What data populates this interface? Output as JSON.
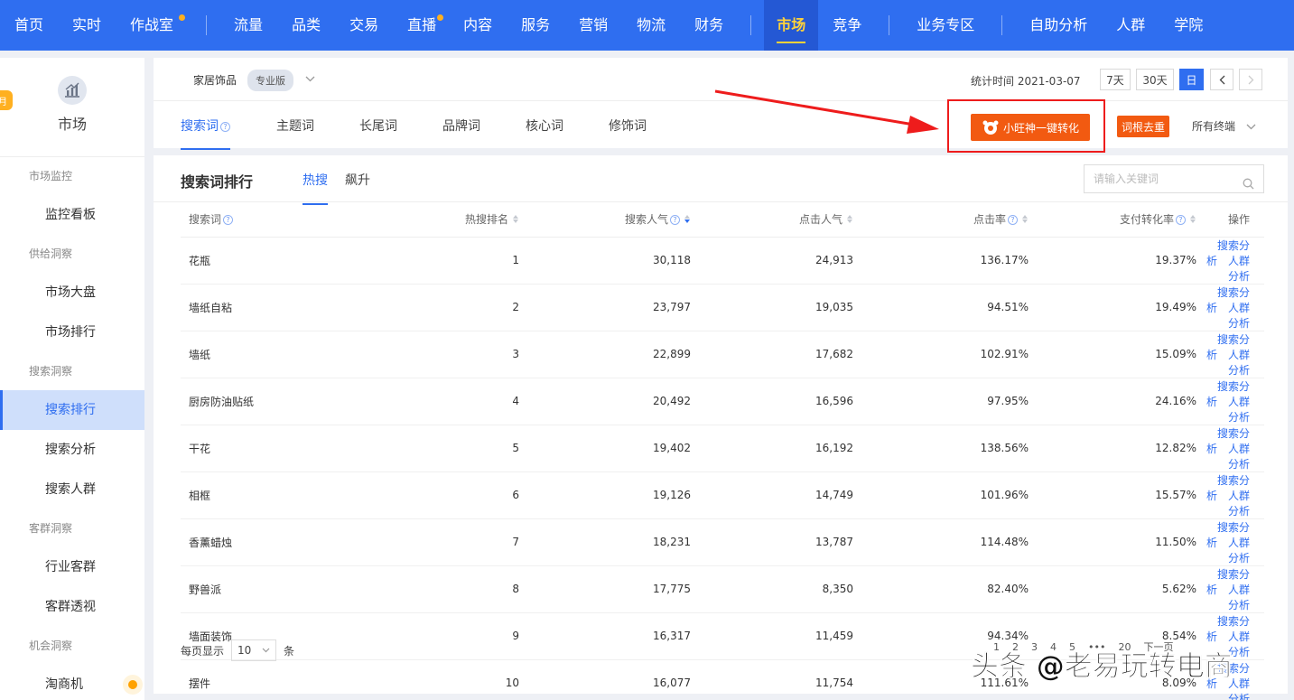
{
  "nav": {
    "items": [
      "首页",
      "实时",
      "作战室",
      "流量",
      "品类",
      "交易",
      "直播",
      "内容",
      "服务",
      "营销",
      "物流",
      "财务",
      "市场",
      "竞争",
      "业务专区",
      "自助分析",
      "人群",
      "学院"
    ],
    "active": "市场"
  },
  "sidebar": {
    "title": "市场",
    "badge": "月",
    "groups": [
      {
        "label": "市场监控",
        "items": [
          "监控看板"
        ]
      },
      {
        "label": "供给洞察",
        "items": [
          "市场大盘",
          "市场排行"
        ]
      },
      {
        "label": "搜索洞察",
        "items": [
          "搜索排行",
          "搜索分析",
          "搜索人群"
        ]
      },
      {
        "label": "客群洞察",
        "items": [
          "行业客群",
          "客群透视"
        ]
      },
      {
        "label": "机会洞察",
        "items": [
          "淘商机"
        ]
      }
    ],
    "active": "搜索排行"
  },
  "header": {
    "category": "家居饰品",
    "edition": "专业版",
    "stat_label": "统计时间 2021-03-07",
    "date_buttons": [
      "7天",
      "30天",
      "日"
    ],
    "tabs": [
      "搜索词",
      "主题词",
      "长尾词",
      "品牌词",
      "核心词",
      "修饰词"
    ],
    "active_tab": "搜索词",
    "convert_button": "小旺神一键转化",
    "dedupe_button": "词根去重",
    "terminal": "所有终端"
  },
  "main": {
    "title": "搜索词排行",
    "subtabs": [
      "热搜",
      "飙升"
    ],
    "active_subtab": "热搜",
    "search_placeholder": "请输入关键词",
    "columns": [
      "搜索词",
      "热搜排名",
      "搜索人气",
      "点击人气",
      "点击率",
      "支付转化率",
      "操作"
    ],
    "rows": [
      {
        "word": "花瓶",
        "rank": "1",
        "search": "30,118",
        "click": "24,913",
        "ctr": "136.17%",
        "cvr": "19.37%"
      },
      {
        "word": "墙纸自粘",
        "rank": "2",
        "search": "23,797",
        "click": "19,035",
        "ctr": "94.51%",
        "cvr": "19.49%"
      },
      {
        "word": "墙纸",
        "rank": "3",
        "search": "22,899",
        "click": "17,682",
        "ctr": "102.91%",
        "cvr": "15.09%"
      },
      {
        "word": "厨房防油贴纸",
        "rank": "4",
        "search": "20,492",
        "click": "16,596",
        "ctr": "97.95%",
        "cvr": "24.16%"
      },
      {
        "word": "干花",
        "rank": "5",
        "search": "19,402",
        "click": "16,192",
        "ctr": "138.56%",
        "cvr": "12.82%"
      },
      {
        "word": "相框",
        "rank": "6",
        "search": "19,126",
        "click": "14,749",
        "ctr": "101.96%",
        "cvr": "15.57%"
      },
      {
        "word": "香薰蜡烛",
        "rank": "7",
        "search": "18,231",
        "click": "13,787",
        "ctr": "114.48%",
        "cvr": "11.50%"
      },
      {
        "word": "野兽派",
        "rank": "8",
        "search": "17,775",
        "click": "8,350",
        "ctr": "82.40%",
        "cvr": "5.62%"
      },
      {
        "word": "墙面装饰",
        "rank": "9",
        "search": "16,317",
        "click": "11,459",
        "ctr": "94.34%",
        "cvr": "8.54%"
      },
      {
        "word": "摆件",
        "rank": "10",
        "search": "16,077",
        "click": "11,754",
        "ctr": "111.61%",
        "cvr": "8.09%"
      }
    ],
    "actions": [
      "搜索分析",
      "人群分析"
    ],
    "page_size_label": "每页显示",
    "page_size": "10",
    "page_size_unit": "条",
    "pages": [
      "1",
      "2",
      "3",
      "4",
      "5",
      "•••",
      "20",
      "下一页"
    ]
  },
  "watermark": "头条 @老易玩转电商",
  "colors": {
    "primary": "#2f6ef0",
    "orange": "#f25a11",
    "highlight": "#ee1c1c"
  }
}
